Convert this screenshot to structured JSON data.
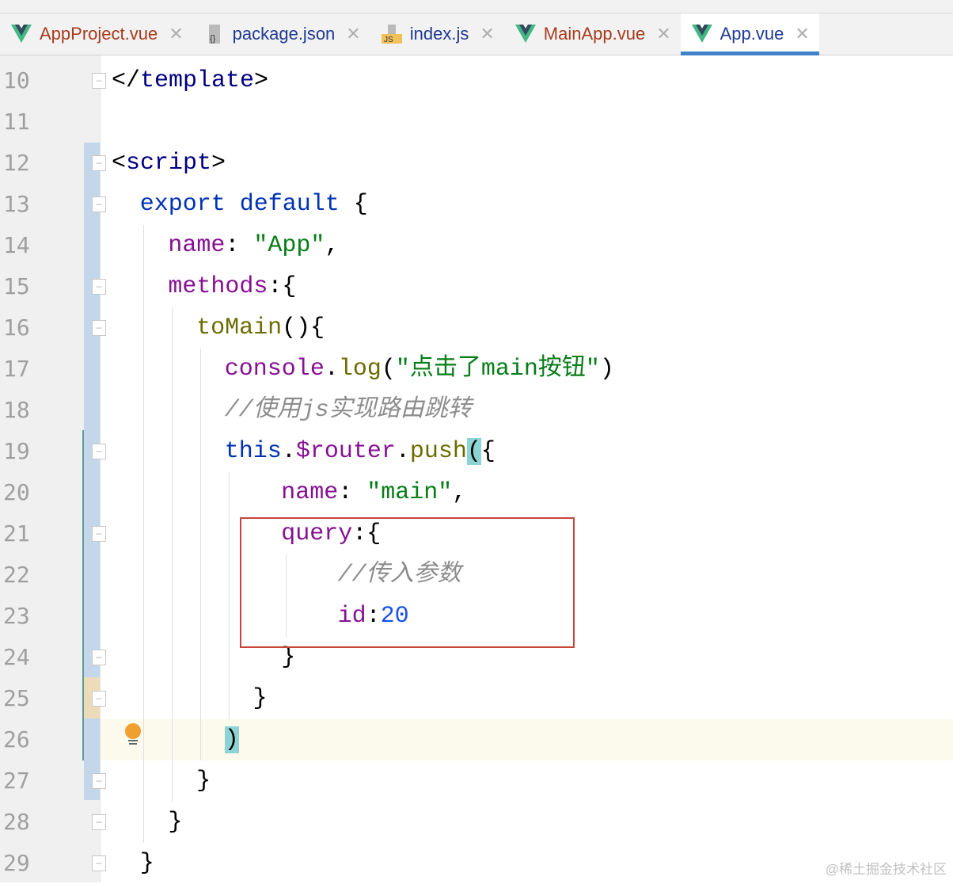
{
  "tabs": [
    {
      "label": "AppProject.vue",
      "icon": "vue-icon",
      "kind": "vue"
    },
    {
      "label": "package.json",
      "icon": "json-file-icon",
      "kind": "json"
    },
    {
      "label": "index.js",
      "icon": "js-file-icon",
      "kind": "json"
    },
    {
      "label": "MainApp.vue",
      "icon": "vue-icon",
      "kind": "vue"
    },
    {
      "label": "App.vue",
      "icon": "vue-icon",
      "kind": "json",
      "active": true
    }
  ],
  "close_glyph": "✕",
  "line_numbers": [
    "10",
    "11",
    "12",
    "13",
    "14",
    "15",
    "16",
    "17",
    "18",
    "19",
    "20",
    "21",
    "22",
    "23",
    "24",
    "25",
    "26",
    "27",
    "28",
    "29"
  ],
  "code": {
    "l10": [
      "</",
      "template",
      ">"
    ],
    "l12": [
      "<",
      "script",
      ">"
    ],
    "l13": [
      "export default",
      " {"
    ],
    "l14": [
      "name",
      ": ",
      "\"App\"",
      ","
    ],
    "l15": [
      "methods",
      ":{"
    ],
    "l16": [
      "toMain",
      "(){"
    ],
    "l17": [
      "console",
      ".",
      "log",
      "(",
      "\"点击了main按钮\"",
      ")"
    ],
    "l18": [
      "//使用js实现路由跳转"
    ],
    "l19": [
      "this",
      ".",
      "$router",
      ".",
      "push",
      "(",
      "{"
    ],
    "l20": [
      "name",
      ": ",
      "\"main\"",
      ","
    ],
    "l21": [
      "query",
      ":{"
    ],
    "l22": [
      "//传入参数"
    ],
    "l23": [
      "id",
      ":",
      "20"
    ],
    "l24": [
      "}"
    ],
    "l25": [
      "}"
    ],
    "l26": [
      ")"
    ],
    "l27": [
      "}"
    ],
    "l28": [
      "}"
    ],
    "l29": [
      "}"
    ]
  },
  "watermark": "@稀土掘金技术社区"
}
